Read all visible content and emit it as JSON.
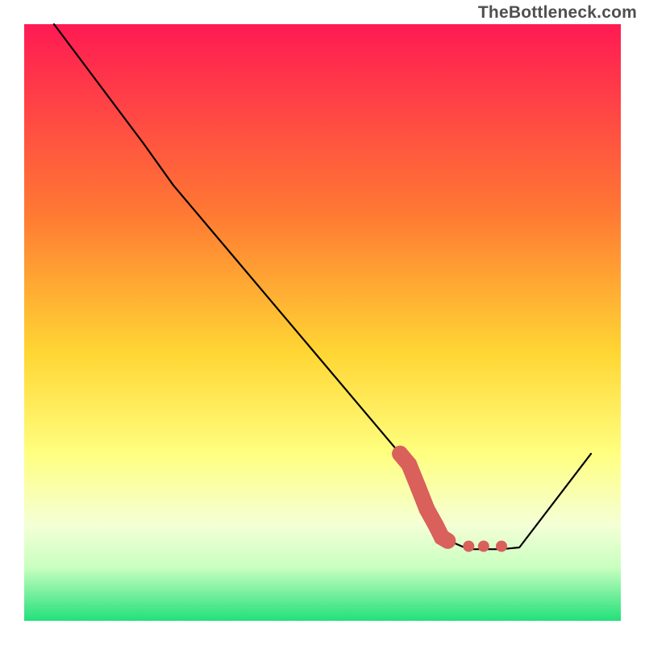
{
  "watermark": "TheBottleneck.com",
  "chart_data": {
    "type": "line",
    "title": "",
    "xlabel": "",
    "ylabel": "",
    "xlim": [
      0,
      100
    ],
    "ylim": [
      0,
      100
    ],
    "series": [
      {
        "name": "curve",
        "points": [
          {
            "x": 5.0,
            "y": 100.0
          },
          {
            "x": 20.0,
            "y": 80.0
          },
          {
            "x": 25.0,
            "y": 73.0
          },
          {
            "x": 63.0,
            "y": 28.0
          },
          {
            "x": 69.5,
            "y": 15.0
          },
          {
            "x": 71.0,
            "y": 13.5
          },
          {
            "x": 74.5,
            "y": 12.0
          },
          {
            "x": 78.0,
            "y": 12.0
          },
          {
            "x": 80.0,
            "y": 12.0
          },
          {
            "x": 83.0,
            "y": 12.3
          },
          {
            "x": 95.0,
            "y": 28.0
          }
        ]
      }
    ],
    "highlight": {
      "name": "highlighted-segment",
      "color": "#d9605b",
      "points": [
        {
          "x": 63.0,
          "y": 28.0
        },
        {
          "x": 64.5,
          "y": 26.2
        },
        {
          "x": 66.0,
          "y": 22.5
        },
        {
          "x": 67.5,
          "y": 18.7
        },
        {
          "x": 69.0,
          "y": 16.0
        },
        {
          "x": 70.0,
          "y": 14.0
        },
        {
          "x": 71.0,
          "y": 13.4
        },
        {
          "x": 74.5,
          "y": 12.5
        },
        {
          "x": 77.0,
          "y": 12.5
        },
        {
          "x": 80.0,
          "y": 12.5
        }
      ]
    },
    "gradient_colors": {
      "top": "#ff1a53",
      "mid1": "#ff7a33",
      "mid2": "#ffd633",
      "mid3": "#ffff80",
      "low1": "#f4ffd6",
      "low2": "#c9ffc0",
      "bottom": "#22e07a"
    }
  }
}
